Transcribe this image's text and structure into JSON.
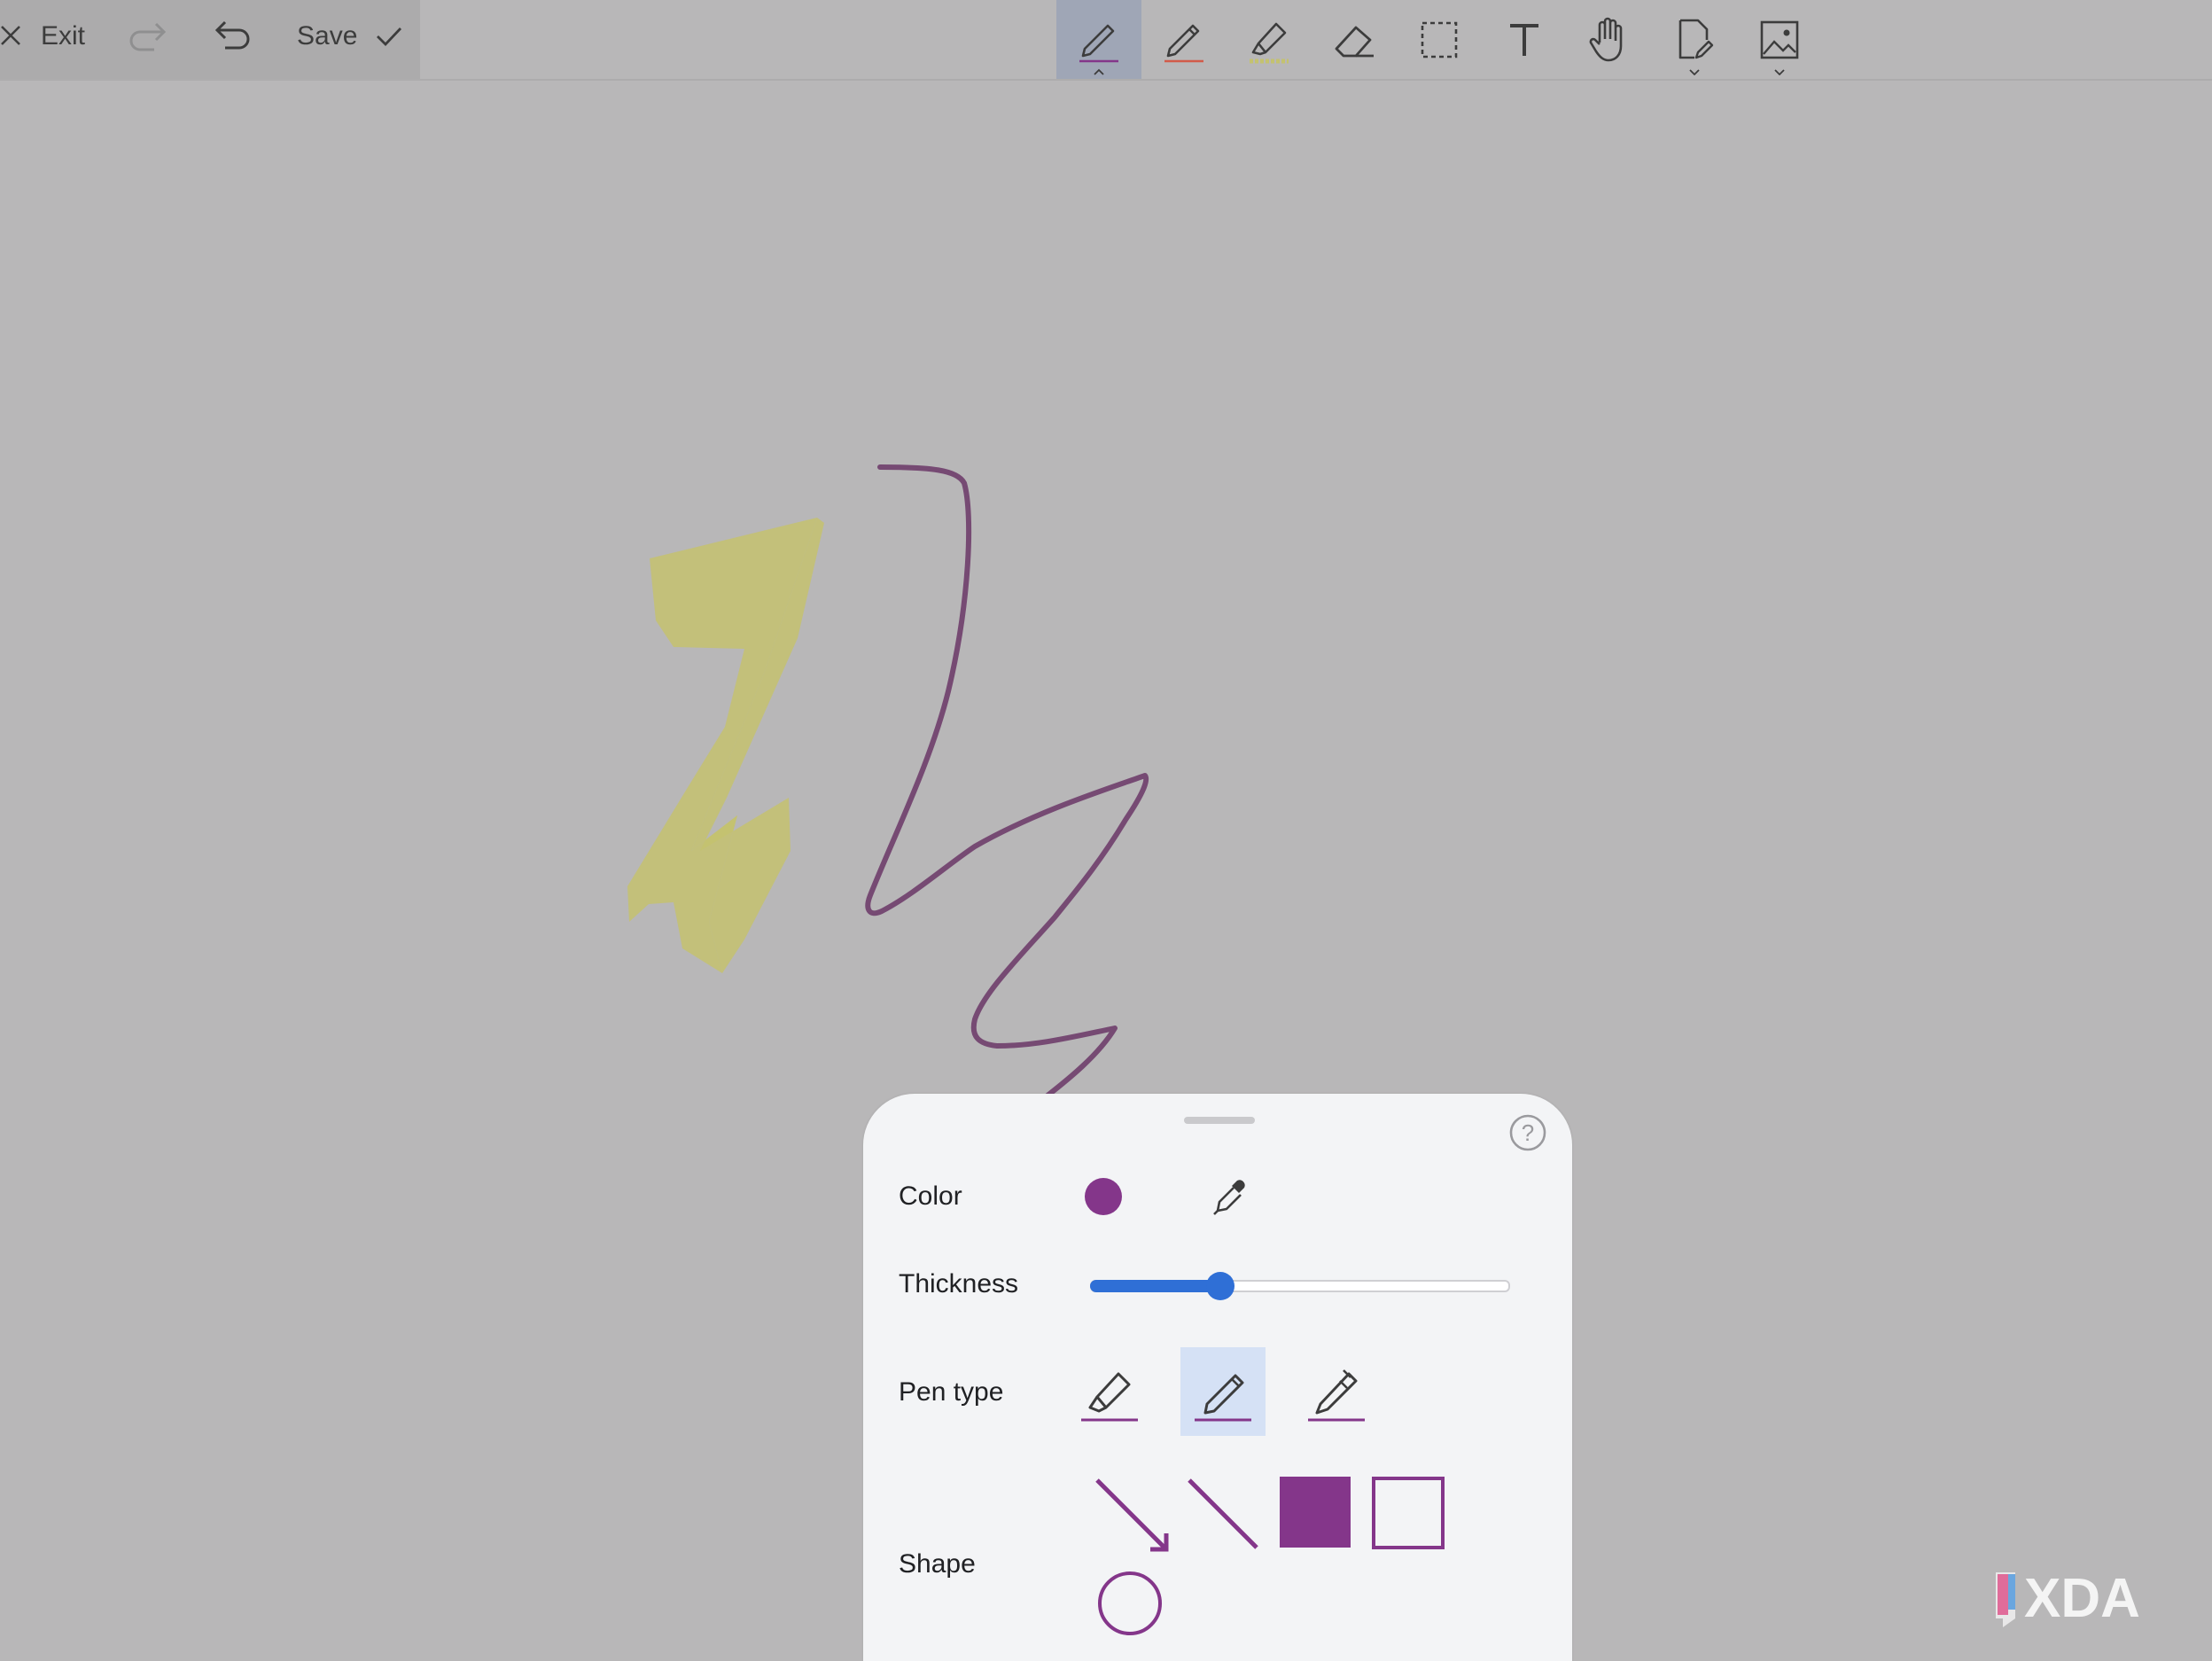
{
  "header": {
    "exit_label": "Exit",
    "save_label": "Save"
  },
  "toolbar": {
    "tools": [
      {
        "name": "pen-tool",
        "icon": "pen-icon",
        "active": true
      },
      {
        "name": "pencil-tool",
        "icon": "pencil-icon",
        "active": false
      },
      {
        "name": "highlighter-tool",
        "icon": "highlighter-icon",
        "active": false
      },
      {
        "name": "eraser-tool",
        "icon": "eraser-icon",
        "active": false
      },
      {
        "name": "selection-tool",
        "icon": "dashed-select-icon",
        "active": false
      },
      {
        "name": "text-tool",
        "icon": "text-icon",
        "active": false
      },
      {
        "name": "pan-tool",
        "icon": "hand-icon",
        "active": false
      },
      {
        "name": "page-tool",
        "icon": "page-edit-icon",
        "active": false
      },
      {
        "name": "image-tool",
        "icon": "image-icon",
        "active": false
      }
    ]
  },
  "panel": {
    "color_label": "Color",
    "thickness_label": "Thickness",
    "pen_type_label": "Pen type",
    "shape_label": "Shape",
    "selected_color": "#84368a",
    "thickness_fraction": 0.31,
    "pen_types": [
      "highlighter-pen",
      "pencil-pen",
      "fountain-pen"
    ],
    "selected_pen_type": "pencil-pen",
    "shapes": [
      "arrow",
      "line",
      "filled-square",
      "outline-square",
      "circle"
    ]
  },
  "colors": {
    "accent": "#84368a",
    "highlight": "#c4c26f",
    "stroke": "#764a73",
    "slider": "#2f6fd6"
  },
  "watermark": {
    "text": "XDA"
  }
}
